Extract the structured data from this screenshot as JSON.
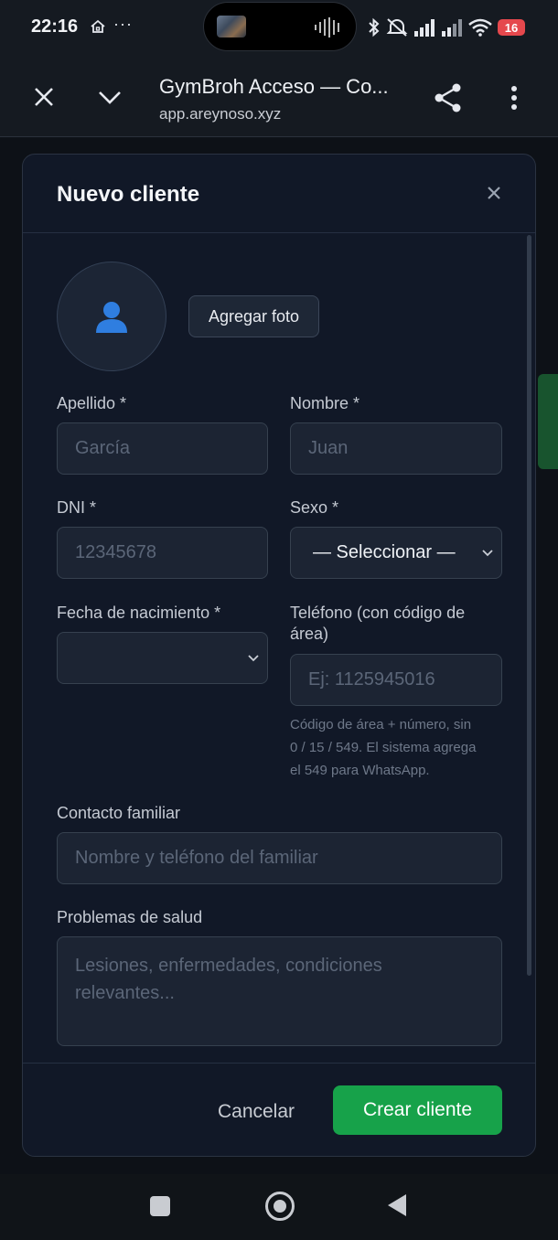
{
  "status": {
    "time": "22:16",
    "battery": "16",
    "home_icon": "home-icon",
    "dots": "···"
  },
  "browser": {
    "title": "GymBroh Acceso — Co...",
    "url": "app.areynoso.xyz"
  },
  "modal": {
    "title": "Nuevo cliente",
    "add_photo": "Agregar foto",
    "fields": {
      "apellido": {
        "label": "Apellido *",
        "placeholder": "García"
      },
      "nombre": {
        "label": "Nombre *",
        "placeholder": "Juan"
      },
      "dni": {
        "label": "DNI *",
        "placeholder": "12345678"
      },
      "sexo": {
        "label": "Sexo *",
        "value": "— Seleccionar —"
      },
      "fecha": {
        "label": "Fecha de nacimiento *",
        "value": ""
      },
      "telefono": {
        "label_line1": "Teléfono (con código de",
        "label_line2": "área)",
        "placeholder": "Ej: 1125945016",
        "help_line1": "Código de área + número, sin",
        "help_line2": "0 / 15 / 549. El sistema agrega",
        "help_line3": "el 549 para WhatsApp."
      },
      "contacto": {
        "label": "Contacto familiar",
        "placeholder": "Nombre y teléfono del familiar"
      },
      "salud": {
        "label": "Problemas de salud",
        "placeholder_line1": "Lesiones, enfermedades, condiciones",
        "placeholder_line2": "relevantes..."
      }
    },
    "footer": {
      "cancel": "Cancelar",
      "create": "Crear cliente"
    }
  },
  "colors": {
    "primary_green": "#17a24a",
    "modal_bg": "#111827",
    "input_bg": "#1c2433"
  }
}
